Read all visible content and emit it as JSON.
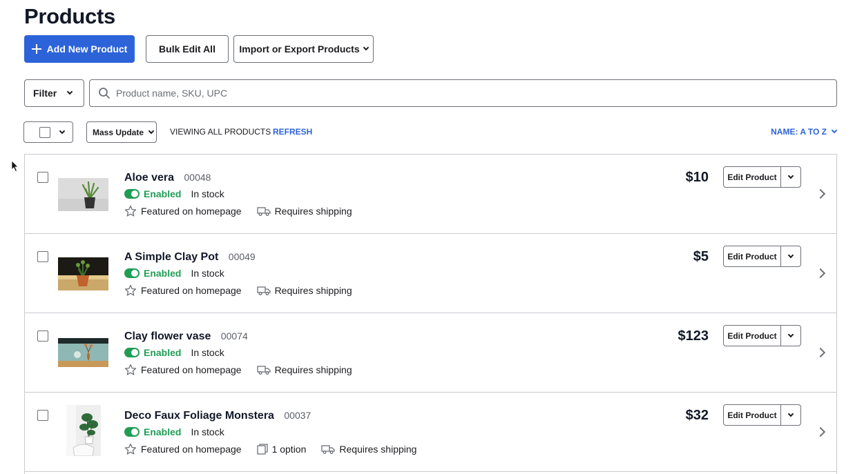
{
  "page": {
    "title": "Products"
  },
  "toolbar": {
    "add_label": "Add New Product",
    "bulk_label": "Bulk Edit All",
    "import_label": "Import or Export Products"
  },
  "search": {
    "filter_label": "Filter",
    "placeholder": "Product name, SKU, UPC",
    "value": ""
  },
  "list_controls": {
    "mass_update_label": "Mass Update",
    "viewing_label": "VIEWING ALL PRODUCTS",
    "refresh_label": "REFRESH",
    "sort_label": "NAME: A TO Z"
  },
  "products": [
    {
      "name": "Aloe vera",
      "sku": "00048",
      "status": "Enabled",
      "stock": "In stock",
      "featured": "Featured on homepage",
      "options": "",
      "shipping": "Requires shipping",
      "price": "$10",
      "edit_label": "Edit Product"
    },
    {
      "name": "A Simple Clay Pot",
      "sku": "00049",
      "status": "Enabled",
      "stock": "In stock",
      "featured": "Featured on homepage",
      "options": "",
      "shipping": "Requires shipping",
      "price": "$5",
      "edit_label": "Edit Product"
    },
    {
      "name": "Clay flower vase",
      "sku": "00074",
      "status": "Enabled",
      "stock": "In stock",
      "featured": "Featured on homepage",
      "options": "",
      "shipping": "Requires shipping",
      "price": "$123",
      "edit_label": "Edit Product"
    },
    {
      "name": "Deco Faux Foliage Monstera",
      "sku": "00037",
      "status": "Enabled",
      "stock": "In stock",
      "featured": "Featured on homepage",
      "options": "1 option",
      "shipping": "Requires shipping",
      "price": "$32",
      "edit_label": "Edit Product"
    }
  ],
  "colors": {
    "primary": "#2d63d9",
    "enabled": "#1f9d55",
    "border": "#c8cacf"
  },
  "icons": [
    "plus-icon",
    "chevron-down-icon",
    "search-icon",
    "star-icon",
    "truck-icon",
    "option-icon",
    "chevron-right-icon",
    "cursor-icon"
  ]
}
